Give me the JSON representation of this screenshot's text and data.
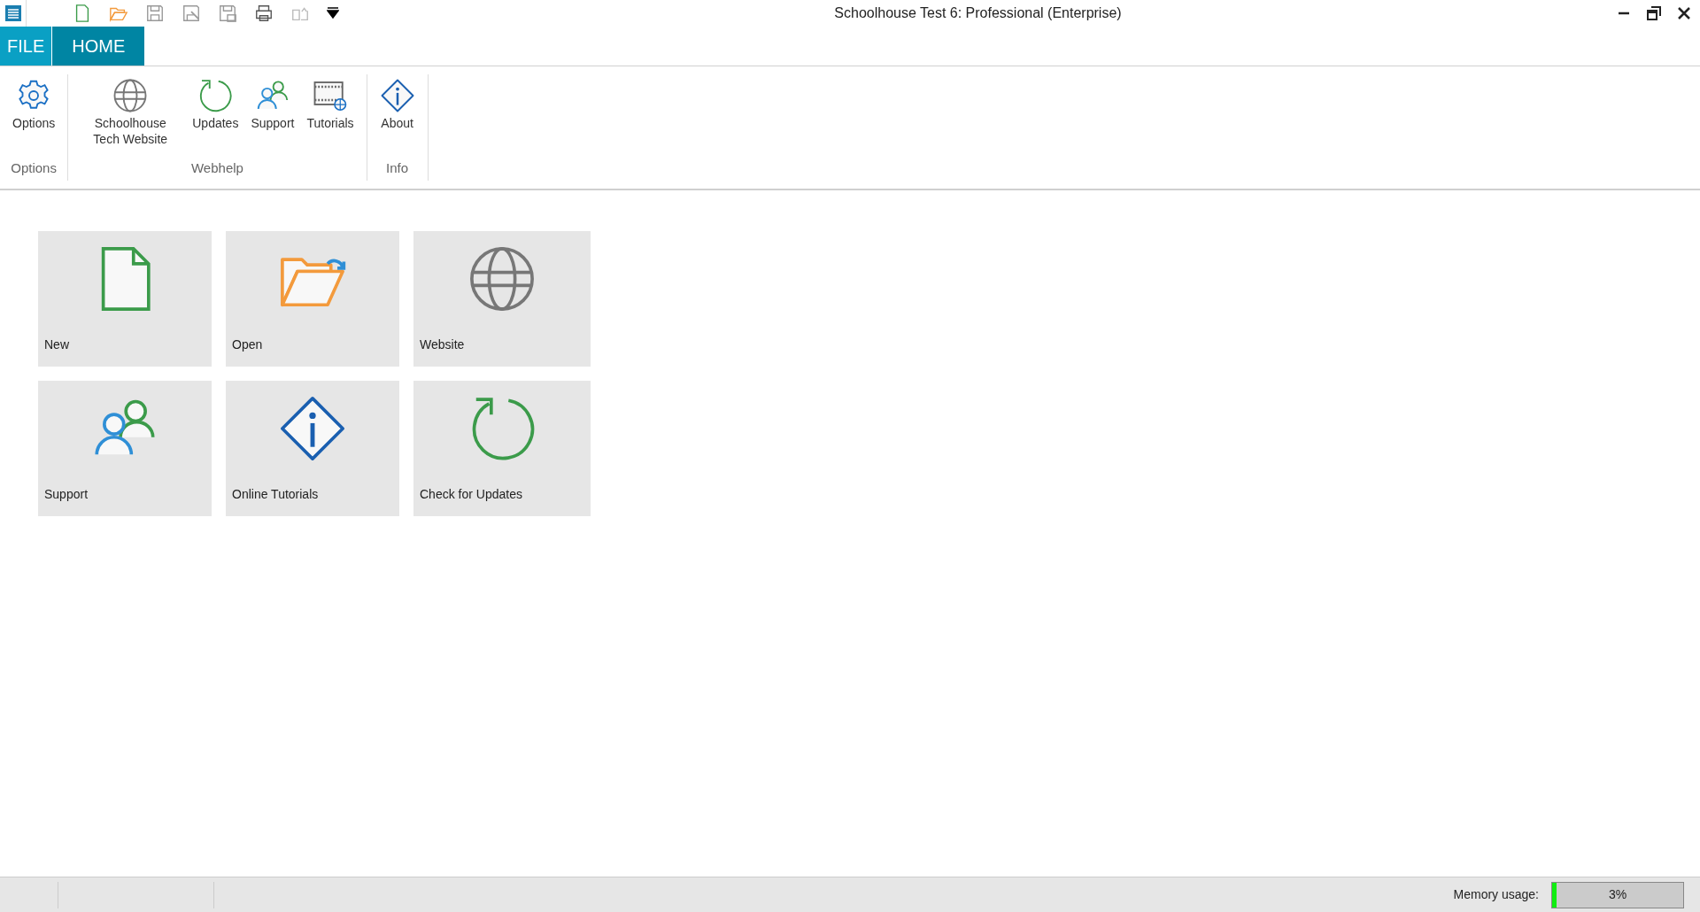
{
  "window": {
    "title": "Schoolhouse Test 6: Professional (Enterprise)"
  },
  "tabs": [
    {
      "label": "FILE",
      "selected": false
    },
    {
      "label": "HOME",
      "selected": true
    }
  ],
  "ribbon_groups": [
    {
      "label": "Options",
      "buttons": [
        {
          "label": "Options",
          "kind": "gear"
        }
      ]
    },
    {
      "label": "Webhelp",
      "buttons": [
        {
          "label": "Schoolhouse Tech Website",
          "kind": "globe"
        },
        {
          "label": "Updates",
          "kind": "refresh"
        },
        {
          "label": "Support",
          "kind": "people"
        },
        {
          "label": "Tutorials",
          "kind": "film"
        }
      ]
    },
    {
      "label": "Info",
      "buttons": [
        {
          "label": "About",
          "kind": "info"
        }
      ]
    }
  ],
  "tiles": [
    {
      "label": "New",
      "kind": "document"
    },
    {
      "label": "Open",
      "kind": "folder"
    },
    {
      "label": "Website",
      "kind": "globe"
    },
    {
      "label": "Support",
      "kind": "people"
    },
    {
      "label": "Online Tutorials",
      "kind": "info"
    },
    {
      "label": "Check for Updates",
      "kind": "refresh"
    }
  ],
  "status_bar": {
    "memory_label": "Memory usage:",
    "memory_reading": "3%",
    "level": 0.03
  }
}
